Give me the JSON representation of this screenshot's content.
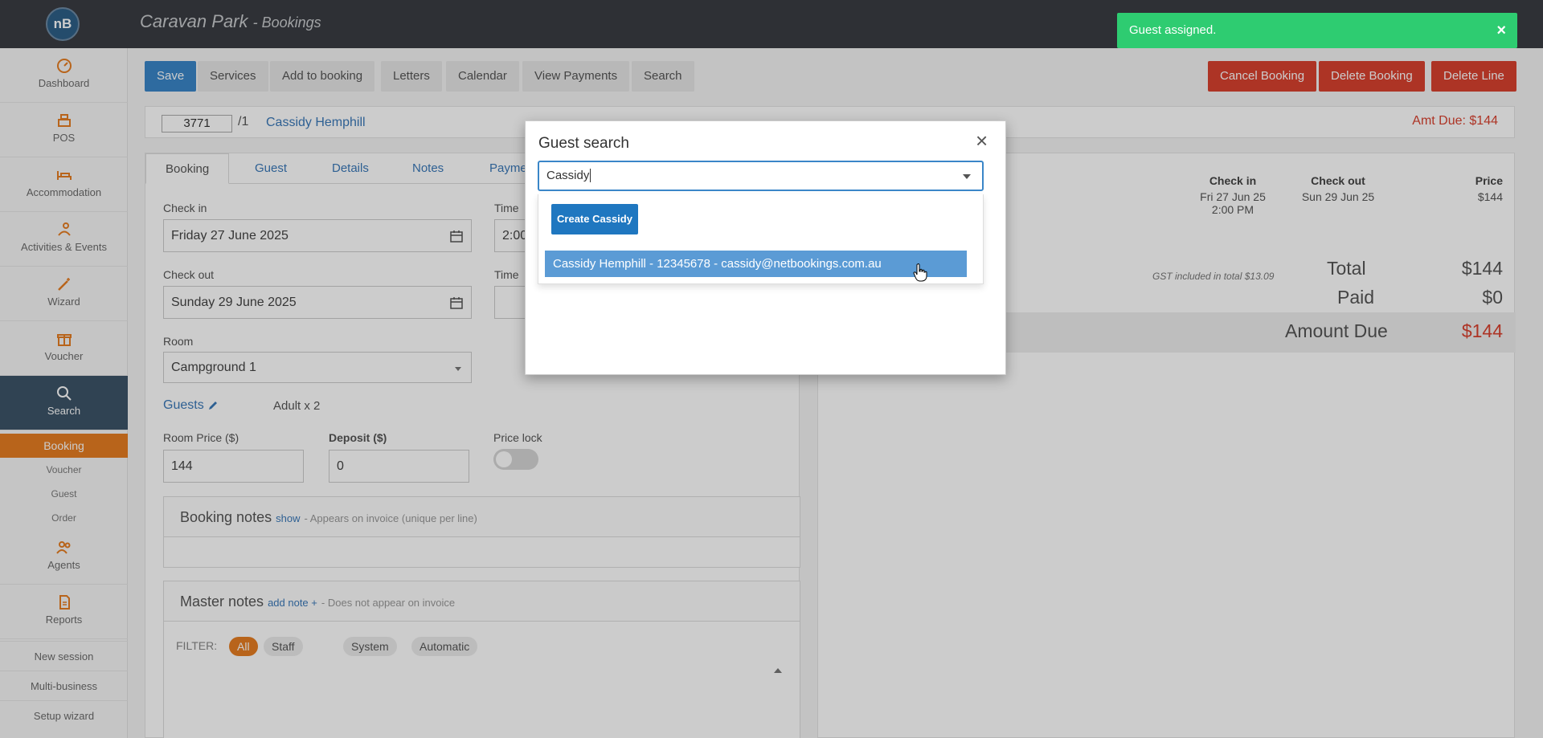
{
  "header": {
    "logo_text": "nB",
    "app_name": "Caravan Park",
    "section": "- Bookings"
  },
  "sidebar": {
    "items": [
      {
        "label": "Dashboard",
        "icon": "dashboard-icon"
      },
      {
        "label": "POS",
        "icon": "register-icon"
      },
      {
        "label": "Accommodation",
        "icon": "bed-icon"
      },
      {
        "label": "Activities & Events",
        "icon": "activities-icon"
      },
      {
        "label": "Wizard",
        "icon": "magic-wand-icon"
      },
      {
        "label": "Voucher",
        "icon": "gift-icon"
      },
      {
        "label": "Search",
        "icon": "search-icon"
      },
      {
        "label": "Agents",
        "icon": "agents-icon"
      },
      {
        "label": "Reports",
        "icon": "reports-icon"
      }
    ],
    "sub_items": [
      "Booking",
      "Voucher",
      "Guest",
      "Order"
    ],
    "links": [
      "New session",
      "Multi-business",
      "Setup wizard"
    ]
  },
  "toolbar": {
    "save": "Save",
    "services": "Services",
    "add_to_booking": "Add to booking",
    "letters": "Letters",
    "calendar": "Calendar",
    "view_payments": "View Payments",
    "search": "Search",
    "cancel_booking": "Cancel Booking",
    "delete_booking": "Delete Booking",
    "delete_line": "Delete Line"
  },
  "booking_ref": {
    "number": "3771",
    "line": "/1",
    "guest_name": "Cassidy Hemphill",
    "amt_due": "Amt Due: $144"
  },
  "tabs": [
    "Booking",
    "Guest",
    "Details",
    "Notes",
    "Payme"
  ],
  "form": {
    "checkin_label": "Check in",
    "checkin_value": "Friday 27 June 2025",
    "time_label": "Time",
    "time_value": "2:00",
    "checkout_label": "Check out",
    "checkout_value": "Sunday 29 June 2025",
    "time2_label": "Time",
    "room_label": "Room",
    "room_value": "Campground 1",
    "guests_label": "Guests",
    "guests_value": "Adult x 2",
    "room_price_label": "Room Price ($)",
    "room_price_value": "144",
    "deposit_label": "Deposit ($)",
    "deposit_value": "0",
    "price_lock_label": "Price lock",
    "price_lock_on": false
  },
  "booking_notes": {
    "title": "Booking notes",
    "show": "show",
    "hint": "- Appears on invoice (unique per line)"
  },
  "master_notes": {
    "title": "Master notes",
    "add": "add note",
    "hint": "- Does not appear on invoice",
    "filter_label": "FILTER:",
    "filters": [
      "All",
      "Staff",
      "System",
      "Automatic"
    ]
  },
  "summary": {
    "checkin_h": "Check in",
    "checkin_d": "Fri 27 Jun 25",
    "checkin_t": "2:00 PM",
    "checkout_h": "Check out",
    "checkout_d": "Sun 29 Jun 25",
    "price_h": "Price",
    "price_v": "$144",
    "gst": "GST included in total $13.09",
    "total_l": "Total",
    "total_v": "$144",
    "paid_l": "Paid",
    "paid_v": "$0",
    "due_l": "Amount Due",
    "due_v": "$144"
  },
  "modal": {
    "title": "Guest search",
    "close": "×",
    "search_value": "Cassidy",
    "create_button": "Create Cassidy",
    "result": "Cassidy Hemphill - 12345678 - cassidy@netbookings.com.au"
  },
  "toast": {
    "message": "Guest assigned.",
    "close": "×"
  },
  "colors": {
    "primary": "#3a86c8",
    "danger": "#d9412f",
    "success": "#2ecc71",
    "accent": "#e67e22",
    "sidebar_active": "#3d5468"
  }
}
